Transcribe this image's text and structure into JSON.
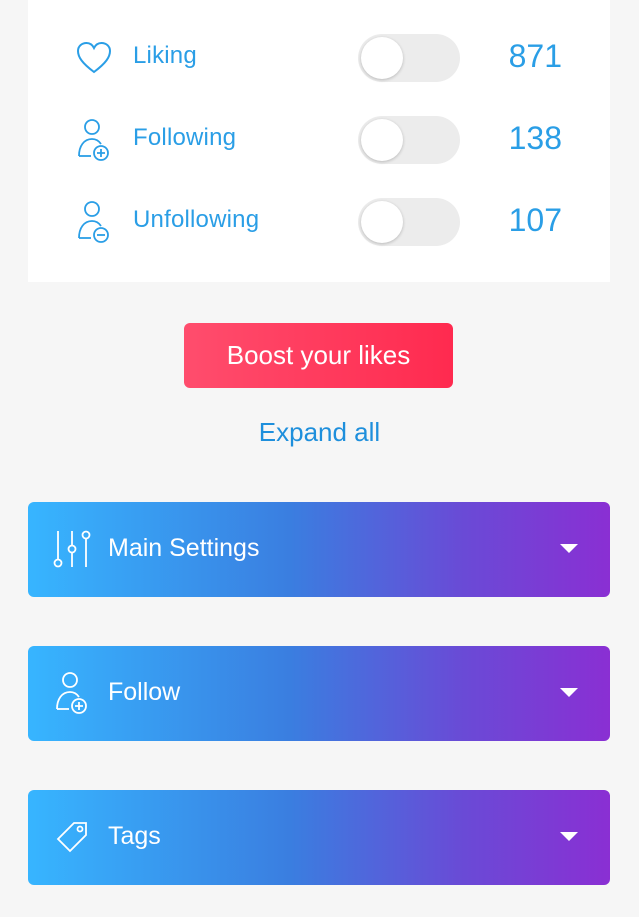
{
  "stats": [
    {
      "label": "Liking",
      "count": "871",
      "icon": "heart-icon",
      "enabled": false
    },
    {
      "label": "Following",
      "count": "138",
      "icon": "user-plus-icon",
      "enabled": false
    },
    {
      "label": "Unfollowing",
      "count": "107",
      "icon": "user-minus-icon",
      "enabled": false
    }
  ],
  "boost_label": "Boost your likes",
  "expand_label": "Expand all",
  "sections": [
    {
      "title": "Main Settings",
      "icon": "sliders-icon"
    },
    {
      "title": "Follow",
      "icon": "user-plus-icon"
    },
    {
      "title": "Tags",
      "icon": "tag-icon"
    }
  ],
  "colors": {
    "accent_text": "#2a9ee6",
    "boost_start": "#ff4d6d",
    "boost_end": "#ff2a4f",
    "gradient_start": "#37b5ff",
    "gradient_end": "#8a2fd3",
    "background": "#f6f6f6"
  }
}
